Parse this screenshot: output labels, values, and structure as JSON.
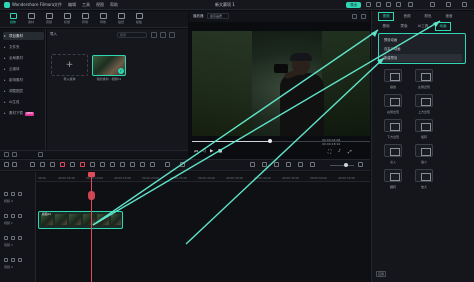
{
  "app": {
    "name": "Wondershare Filmora",
    "menu": [
      "文件",
      "编辑",
      "工具",
      "视图",
      "帮助"
    ],
    "project_title": "新大赛项 1",
    "export_label": "导出"
  },
  "toolbar": {
    "tools": [
      {
        "label": "媒体",
        "icon": "media-icon"
      },
      {
        "label": "素材",
        "icon": "stock-icon"
      },
      {
        "label": "音频",
        "icon": "music-icon"
      },
      {
        "label": "标题",
        "icon": "title-icon"
      },
      {
        "label": "转场",
        "icon": "transition-icon"
      },
      {
        "label": "特效",
        "icon": "effects-icon"
      },
      {
        "label": "贴纸",
        "icon": "sticker-icon"
      },
      {
        "label": "模板",
        "icon": "template-icon"
      }
    ]
  },
  "sidebar": {
    "items": [
      {
        "label": "项目素材",
        "active": true
      },
      {
        "label": "文件夹"
      },
      {
        "label": "全局素材"
      },
      {
        "label": "云媒体"
      },
      {
        "label": "影响素材"
      },
      {
        "label": "调整图层"
      },
      {
        "label": "AI生成"
      },
      {
        "label": "素材下载",
        "badge": "NEW"
      }
    ]
  },
  "media": {
    "import_label": "导入",
    "search_placeholder": "搜索",
    "add_label": "导入媒体",
    "thumb_label": "我的素材 · 视频01"
  },
  "preview": {
    "player_label": "播放器",
    "quality": "最高品质",
    "time_current": "00:00:02:08",
    "time_total": "00:00:18:10",
    "progress": 0.44
  },
  "right_panel": {
    "tabs": [
      "视频",
      "音频",
      "颜色",
      "速度"
    ],
    "sub_tabs": [
      "基础",
      "蒙版",
      "AI工具",
      "动画"
    ],
    "dropdown_items": [
      "预设动画",
      "自定义动画",
      "新建预设"
    ],
    "transitions": [
      {
        "label": "缩放"
      },
      {
        "label": "左侧出现"
      },
      {
        "label": "右侧出现"
      },
      {
        "label": "上方出现"
      },
      {
        "label": "下方出现"
      },
      {
        "label": "旋转"
      },
      {
        "label": "淡入"
      },
      {
        "label": "缩小"
      },
      {
        "label": "翻转"
      },
      {
        "label": "放大"
      }
    ],
    "apply_label": "应用"
  },
  "timeline": {
    "ticks": [
      "00:00",
      "00:00:05:00",
      "00:00:10:00",
      "00:00:15:00",
      "00:00:20:00",
      "00:00:25:00",
      "00:00:30:00",
      "00:00:35:00",
      "00:00:40:00",
      "00:00:45:00",
      "00:00:50:00",
      "00:00:55:00"
    ],
    "tracks": [
      {
        "label": "视频 2"
      },
      {
        "label": "视频 1"
      },
      {
        "label": "音频 1"
      },
      {
        "label": "音频 2"
      }
    ],
    "clip_label": "视频01"
  }
}
